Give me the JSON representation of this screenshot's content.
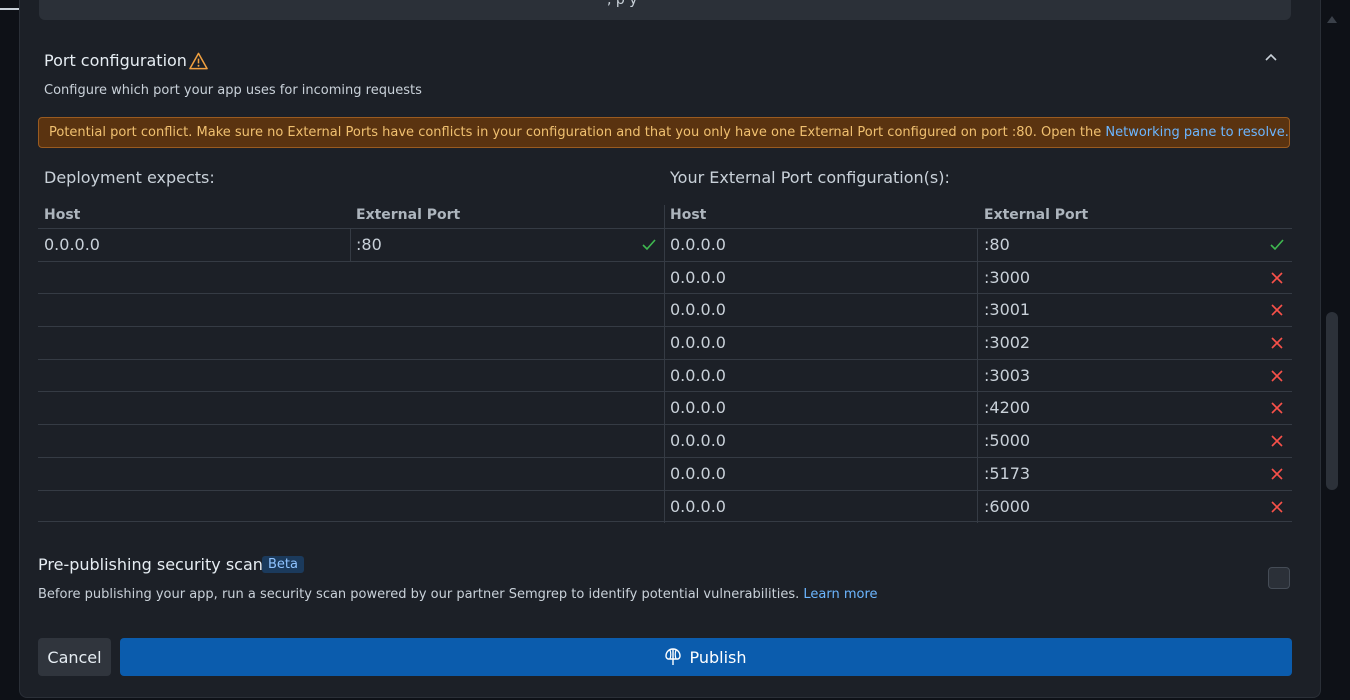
{
  "previous_card": {
    "fragment": ",       p y"
  },
  "port_config": {
    "title": "Port configuration",
    "subtitle": "Configure which port your app uses for incoming requests",
    "warning": {
      "text": "Potential port conflict. Make sure no External Ports have conflicts in your configuration and that you only have one External Port configured on port :80. Open the ",
      "link": "Networking pane to resolve."
    },
    "deployment_heading": "Deployment expects:",
    "external_heading": "Your External Port configuration(s):",
    "headers": {
      "host": "Host",
      "port": "External Port"
    },
    "expected": {
      "host": "0.0.0.0",
      "port": ":80",
      "status": "ok"
    },
    "configs": [
      {
        "host": "0.0.0.0",
        "port": ":80",
        "status": "ok"
      },
      {
        "host": "0.0.0.0",
        "port": ":3000",
        "status": "conflict"
      },
      {
        "host": "0.0.0.0",
        "port": ":3001",
        "status": "conflict"
      },
      {
        "host": "0.0.0.0",
        "port": ":3002",
        "status": "conflict"
      },
      {
        "host": "0.0.0.0",
        "port": ":3003",
        "status": "conflict"
      },
      {
        "host": "0.0.0.0",
        "port": ":4200",
        "status": "conflict"
      },
      {
        "host": "0.0.0.0",
        "port": ":5000",
        "status": "conflict"
      },
      {
        "host": "0.0.0.0",
        "port": ":5173",
        "status": "conflict"
      },
      {
        "host": "0.0.0.0",
        "port": ":6000",
        "status": "conflict"
      }
    ]
  },
  "security_scan": {
    "title": "Pre-publishing security scan",
    "badge": "Beta",
    "description": "Before publishing your app, run a security scan powered by our partner Semgrep to identify potential vulnerabilities. ",
    "link": "Learn more",
    "checked": false
  },
  "actions": {
    "cancel": "Cancel",
    "publish": "Publish"
  },
  "colors": {
    "ok": "#3fb950",
    "conflict": "#f85149",
    "accent": "#0b5cad",
    "warning": "#f0a040"
  }
}
